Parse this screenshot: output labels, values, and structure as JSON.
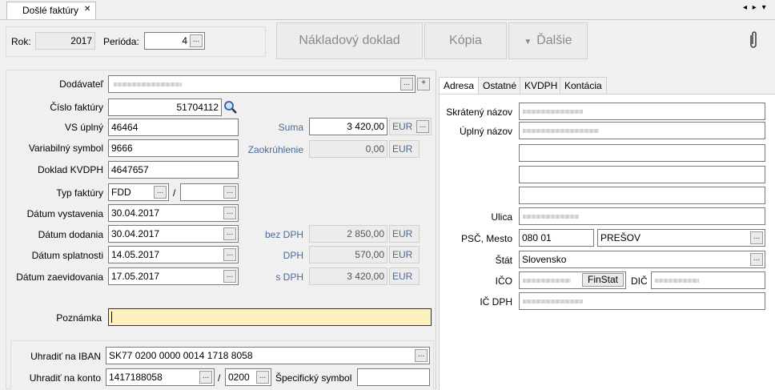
{
  "tab_title": "Došlé faktúry",
  "tab_close": "✕",
  "nav_arrows": "◂ ▸ ▾",
  "top": {
    "rok_label": "Rok:",
    "rok_value": "2017",
    "perioda_label": "Perióda:",
    "perioda_value": "4",
    "btn_nakladovy": "Nákladový doklad",
    "btn_kopia": "Kópia",
    "btn_dalsie": "Ďalšie",
    "dalsie_arrow": "▼",
    "attach_icon": "paperclip-icon"
  },
  "left": {
    "dodavatel_label": "Dodávateľ",
    "cislo_faktury_label": "Číslo faktúry",
    "cislo_faktury_value": "51704112",
    "vs_uplny_label": "VS úplný",
    "vs_uplny_value": "46464",
    "variabilny_symbol_label": "Variabilný symbol",
    "variabilny_symbol_value": "9666",
    "doklad_kvdph_label": "Doklad KVDPH",
    "doklad_kvdph_value": "4647657",
    "typ_faktury_label": "Typ faktúry",
    "typ_faktury_value": "FDD",
    "typ_sep": "/",
    "datum_vystavenia_label": "Dátum vystavenia",
    "datum_vystavenia_value": "30.04.2017",
    "datum_dodania_label": "Dátum dodania",
    "datum_dodania_value": "30.04.2017",
    "datum_splatnosti_label": "Dátum splatnosti",
    "datum_splatnosti_value": "14.05.2017",
    "datum_zaevidovania_label": "Dátum zaevidovania",
    "datum_zaevidovania_value": "17.05.2017",
    "suma_label": "Suma",
    "suma_value": "3 420,00",
    "zaokruhlenie_label": "Zaokrúhlenie",
    "zaokruhlenie_value": "0,00",
    "bez_dph_label": "bez DPH",
    "bez_dph_value": "2 850,00",
    "dph_label": "DPH",
    "dph_value": "570,00",
    "s_dph_label": "s DPH",
    "s_dph_value": "3 420,00",
    "currency": "EUR",
    "poznamka_label": "Poznámka",
    "iban_label": "Uhradiť na IBAN",
    "iban_value": "SK77 0200 0000 0014 1718 8058",
    "konto_label": "Uhradiť na konto",
    "konto_value": "1417188058",
    "konto_sep": "/",
    "bank_code": "0200",
    "specificky_label": "Špecifický symbol"
  },
  "right": {
    "tabs": [
      "Adresa",
      "Ostatné",
      "KVDPH",
      "Kontácia"
    ],
    "skrateny_label": "Skrátený názov",
    "uplny_label": "Úplný názov",
    "ulica_label": "Ulica",
    "psc_label": "PSČ, Mesto",
    "psc_value": "080 01",
    "mesto_value": "PREŠOV",
    "stat_label": "Štát",
    "stat_value": "Slovensko",
    "ico_label": "IČO",
    "finstat_label": "FinStat",
    "dic_label": "DIČ",
    "icdph_label": "IČ DPH"
  },
  "colors": {
    "note_bg": "#fdf1c0",
    "label_blue": "#4a6a9a"
  }
}
